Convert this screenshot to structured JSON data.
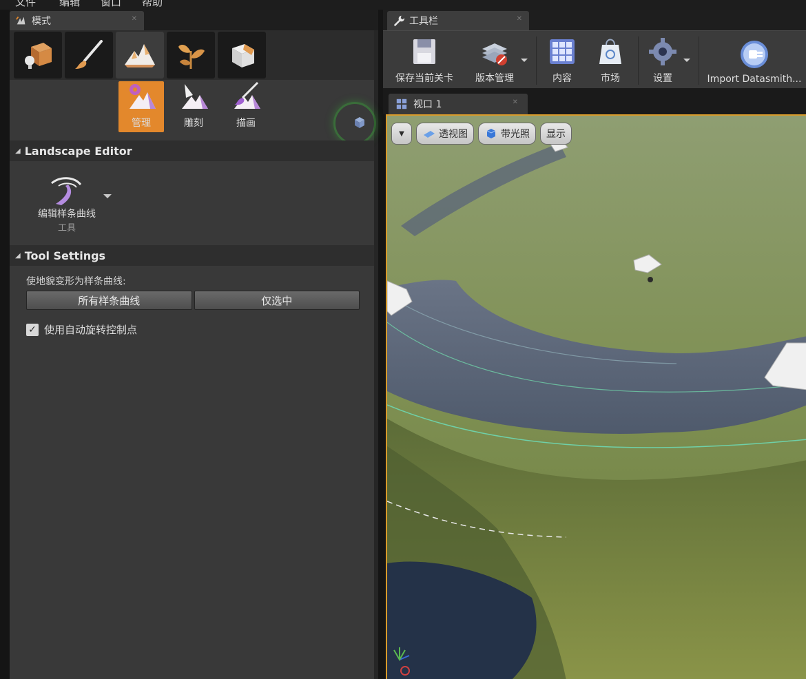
{
  "menu": {
    "items": [
      "文件",
      "编辑",
      "窗口",
      "帮助"
    ]
  },
  "left_tab": {
    "title": "模式"
  },
  "mode_buttons": [
    "placement-mode",
    "paint-mode",
    "landscape-mode",
    "foliage-mode",
    "geometry-mode"
  ],
  "landscape_subtools": {
    "manage": "管理",
    "sculpt": "雕刻",
    "paint": "描画"
  },
  "landscape_editor": {
    "header": "Landscape Editor",
    "tool_label": "编辑样条曲线",
    "tool_sublabel": "工具"
  },
  "tool_settings": {
    "header": "Tool Settings",
    "description": "使地貌变形为样条曲线:",
    "button_all": "所有样条曲线",
    "button_selected": "仅选中",
    "checkbox_label": "使用自动旋转控制点",
    "checkbox_checked": true
  },
  "toolbar_tab": {
    "title": "工具栏"
  },
  "toolbar": {
    "save": "保存当前关卡",
    "source_control": "版本管理",
    "content": "内容",
    "marketplace": "市场",
    "settings": "设置",
    "datasmith": "Import Datasmith..."
  },
  "viewport_tab": {
    "title": "视口 1"
  },
  "viewport_toolbar": {
    "perspective": "透视图",
    "lit": "带光照",
    "show": "显示"
  },
  "colors": {
    "accent_orange": "#e3882c",
    "viewport_border": "#d89a2a",
    "panel_bg": "#393939"
  }
}
